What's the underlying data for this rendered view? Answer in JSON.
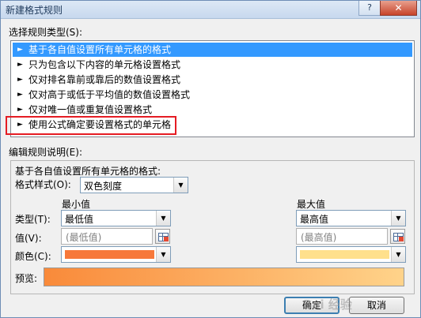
{
  "window": {
    "title": "新建格式规则",
    "help_label": "?",
    "close_label": "✕"
  },
  "rule_type": {
    "label": "选择规则类型(S):",
    "items": [
      {
        "label": "基于各自值设置所有单元格的格式",
        "selected": true
      },
      {
        "label": "只为包含以下内容的单元格设置格式",
        "selected": false
      },
      {
        "label": "仅对排名靠前或靠后的数值设置格式",
        "selected": false
      },
      {
        "label": "仅对高于或低于平均值的数值设置格式",
        "selected": false
      },
      {
        "label": "仅对唯一值或重复值设置格式",
        "selected": false
      },
      {
        "label": "使用公式确定要设置格式的单元格",
        "selected": false
      }
    ],
    "arrow": "►"
  },
  "rule_desc": {
    "label": "编辑规则说明(E):",
    "heading": "基于各自值设置所有单元格的格式:",
    "format_style_label": "格式样式(O):",
    "format_style_value": "双色刻度",
    "min_header": "最小值",
    "max_header": "最大值",
    "type_label": "类型(T):",
    "value_label": "值(V):",
    "color_label": "颜色(C):",
    "min_type": "最低值",
    "max_type": "最高值",
    "min_value_placeholder": "(最低值)",
    "max_value_placeholder": "(最高值)",
    "min_color": "#f7783a",
    "max_color": "#ffe08c",
    "preview_label": "预览:"
  },
  "buttons": {
    "ok_label": "确定",
    "cancel_label": "取消"
  },
  "colors": {
    "selection": "#3399ff",
    "highlight_box": "#e51c23",
    "preview_start": "#f98a3a",
    "preview_end": "#ffd38a"
  },
  "icons": {
    "dropdown": "▼",
    "reference": "range-select-icon"
  }
}
